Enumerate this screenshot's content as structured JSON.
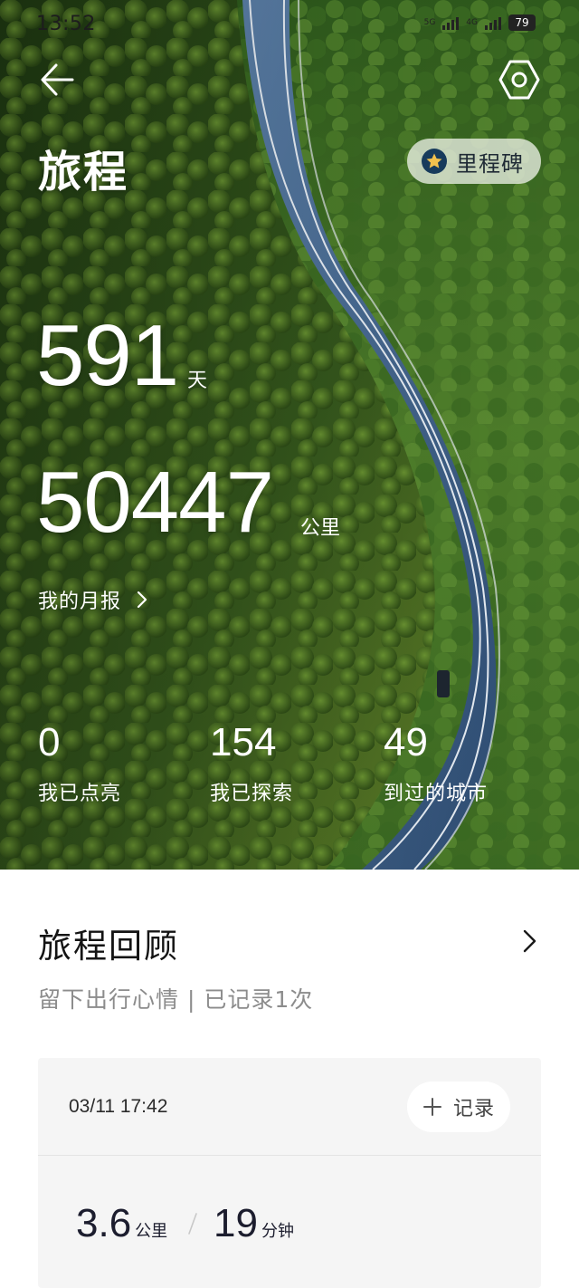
{
  "status_bar": {
    "time": "13:52",
    "network_1": "5G",
    "network_2": "4G",
    "battery": "79"
  },
  "header": {
    "back_icon": "arrow-left-icon",
    "settings_icon": "hexagon-settings-icon",
    "title": "旅程",
    "milestone_label": "里程碑",
    "milestone_icon": "star-badge-icon"
  },
  "summary": {
    "days_value": "591",
    "days_unit": "天",
    "distance_value": "50447",
    "distance_unit": "公里",
    "monthly_report_label": "我的月报"
  },
  "stats": [
    {
      "value": "0",
      "label": "我已点亮"
    },
    {
      "value": "154",
      "label": "我已探索"
    },
    {
      "value": "49",
      "label": "到过的城市"
    }
  ],
  "review": {
    "title": "旅程回顾",
    "subtitle": "留下出行心情 | 已记录1次",
    "card": {
      "date": "03/11 17:42",
      "record_label": "记录",
      "distance_value": "3.6",
      "distance_unit": "公里",
      "duration_value": "19",
      "duration_unit": "分钟"
    }
  },
  "colors": {
    "forest_dark": "#2f4a1c",
    "forest_light": "#6f8f3a",
    "road": "#3d5a80",
    "text_dark": "#141414",
    "text_muted": "#8c8c8c",
    "card_bg": "#f5f5f5"
  }
}
